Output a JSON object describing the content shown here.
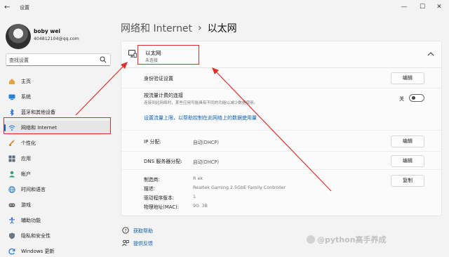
{
  "window": {
    "app_title": "设置",
    "back_glyph": "←",
    "minimize_glyph": "—",
    "maximize_glyph": "☐",
    "close_glyph": "✕"
  },
  "profile": {
    "name": "boby wei",
    "email": "404812104@qq.com"
  },
  "search": {
    "placeholder": "查找设置"
  },
  "sidebar": {
    "items": [
      {
        "label": "主页",
        "icon": "home-icon",
        "color": "#e9a23b"
      },
      {
        "label": "系统",
        "icon": "system-icon",
        "color": "#2b7fd9"
      },
      {
        "label": "蓝牙和其他设备",
        "icon": "bluetooth-icon",
        "color": "#1f6fd0"
      },
      {
        "label": "网络和 Internet",
        "icon": "wifi-icon",
        "color": "#3a8ee6"
      },
      {
        "label": "个性化",
        "icon": "brush-icon",
        "color": "#d6862a"
      },
      {
        "label": "应用",
        "icon": "apps-icon",
        "color": "#5b6b7d"
      },
      {
        "label": "帐户",
        "icon": "account-icon",
        "color": "#2fa37a"
      },
      {
        "label": "时间和语言",
        "icon": "globe-icon",
        "color": "#2a78c8"
      },
      {
        "label": "游戏",
        "icon": "gamepad-icon",
        "color": "#6a6a6a"
      },
      {
        "label": "辅助功能",
        "icon": "accessibility-icon",
        "color": "#2b6ecf"
      },
      {
        "label": "隐私和安全性",
        "icon": "shield-icon",
        "color": "#6b7785"
      },
      {
        "label": "Windows 更新",
        "icon": "update-icon",
        "color": "#1e73d8"
      }
    ]
  },
  "breadcrumb": {
    "parent": "网络和 Internet",
    "separator": "›",
    "current": "以太网"
  },
  "ethernet": {
    "name": "以太网",
    "status": "未连接",
    "auth_label": "身份验证设置",
    "metered_label": "按流量计费的连接",
    "metered_desc": "连接到此网络时，某些应用可能具有不同的功能以减少数据使用。",
    "metered_state": "关",
    "data_limit_link": "设置流量上限，以帮助控制在此网络上的数据使用量",
    "ip_label": "IP 分配:",
    "ip_value": "自动(DHCP)",
    "dns_label": "DNS 服务器分配:",
    "dns_value": "自动(DHCP)",
    "manufacturer_label": "制造商:",
    "manufacturer_value": "R    ek",
    "description_label": "描述:",
    "description_value": "Realtek Gaming 2.5GbE Family Controller",
    "driver_label": "驱动程序版本:",
    "driver_value": "1",
    "mac_label": "物理地址(MAC):",
    "mac_value": "90-   3B",
    "edit_label": "编辑",
    "copy_label": "复制"
  },
  "help": {
    "get_help": "获取帮助",
    "feedback": "提供反馈"
  },
  "watermark": "@python高手养成",
  "colors": {
    "accent": "#0067c0",
    "annotation": "#e0302b",
    "link": "#0a5fb5"
  }
}
